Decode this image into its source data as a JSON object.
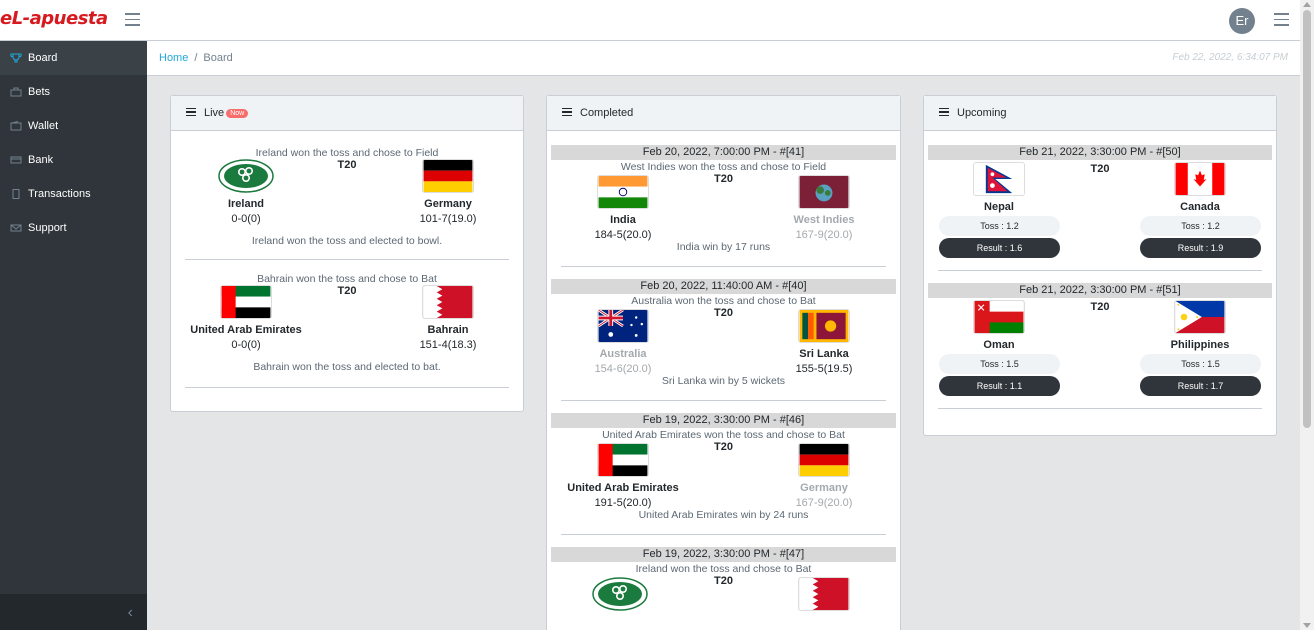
{
  "app": {
    "brand": "eL-apuesta",
    "user_initials": "Er"
  },
  "sidebar": {
    "items": [
      {
        "label": "Board",
        "icon": "trophy-icon"
      },
      {
        "label": "Bets",
        "icon": "briefcase-icon"
      },
      {
        "label": "Wallet",
        "icon": "wallet-icon"
      },
      {
        "label": "Bank",
        "icon": "bank-icon"
      },
      {
        "label": "Transactions",
        "icon": "file-icon"
      },
      {
        "label": "Support",
        "icon": "envelope-icon"
      }
    ]
  },
  "breadcrumb": {
    "home": "Home",
    "separator": "/",
    "current": "Board"
  },
  "timestamp": "Feb 22, 2022, 6:34:07 PM",
  "live": {
    "title": "Live",
    "badge": "Now",
    "matches": [
      {
        "toss": "Ireland won the toss and chose to Field",
        "format": "T20",
        "team1": {
          "name": "Ireland",
          "score": "0-0(0)",
          "flag": "ireland-cricket-flag"
        },
        "team2": {
          "name": "Germany",
          "score": "101-7(19.0)",
          "flag": "germany-flag"
        },
        "note": "Ireland won the toss and elected to bowl."
      },
      {
        "toss": "Bahrain won the toss and chose to Bat",
        "format": "T20",
        "team1": {
          "name": "United Arab Emirates",
          "score": "0-0(0)",
          "flag": "uae-flag"
        },
        "team2": {
          "name": "Bahrain",
          "score": "151-4(18.3)",
          "flag": "bahrain-flag"
        },
        "note": "Bahrain won the toss and elected to bat."
      }
    ]
  },
  "completed": {
    "title": "Completed",
    "matches": [
      {
        "header": "Feb 20, 2022, 7:00:00 PM - #[41]",
        "toss": "West Indies won the toss and chose to Field",
        "format": "T20",
        "team1": {
          "name": "India",
          "score": "184-5(20.0)",
          "flag": "india-flag"
        },
        "team2": {
          "name": "West Indies",
          "score": "167-9(20.0)",
          "flag": "west-indies-flag"
        },
        "result": "India win by 17 runs"
      },
      {
        "header": "Feb 20, 2022, 11:40:00 AM - #[40]",
        "toss": "Australia won the toss and chose to Bat",
        "format": "T20",
        "team1": {
          "name": "Australia",
          "score": "154-6(20.0)",
          "flag": "australia-flag"
        },
        "team2": {
          "name": "Sri Lanka",
          "score": "155-5(19.5)",
          "flag": "sri-lanka-flag"
        },
        "result": "Sri Lanka win by 5 wickets"
      },
      {
        "header": "Feb 19, 2022, 3:30:00 PM - #[46]",
        "toss": "United Arab Emirates won the toss and chose to Bat",
        "format": "T20",
        "team1": {
          "name": "United Arab Emirates",
          "score": "191-5(20.0)",
          "flag": "uae-flag"
        },
        "team2": {
          "name": "Germany",
          "score": "167-9(20.0)",
          "flag": "germany-flag"
        },
        "result": "United Arab Emirates win by 24 runs"
      },
      {
        "header": "Feb 19, 2022, 3:30:00 PM - #[47]",
        "toss": "Ireland won the toss and chose to Bat",
        "format": "T20",
        "team1": {
          "flag": "ireland-cricket-flag"
        },
        "team2": {
          "flag": "bahrain-flag"
        }
      }
    ]
  },
  "upcoming": {
    "title": "Upcoming",
    "matches": [
      {
        "header": "Feb 21, 2022, 3:30:00 PM - #[50]",
        "format": "T20",
        "team1": {
          "name": "Nepal",
          "toss": "Toss : 1.2",
          "result": "Result : 1.6",
          "flag": "nepal-flag"
        },
        "team2": {
          "name": "Canada",
          "toss": "Toss : 1.2",
          "result": "Result : 1.9",
          "flag": "canada-flag"
        }
      },
      {
        "header": "Feb 21, 2022, 3:30:00 PM - #[51]",
        "format": "T20",
        "team1": {
          "name": "Oman",
          "toss": "Toss : 1.5",
          "result": "Result : 1.1",
          "flag": "oman-flag"
        },
        "team2": {
          "name": "Philippines",
          "toss": "Toss : 1.5",
          "result": "Result : 1.7",
          "flag": "philippines-flag"
        }
      }
    ]
  }
}
